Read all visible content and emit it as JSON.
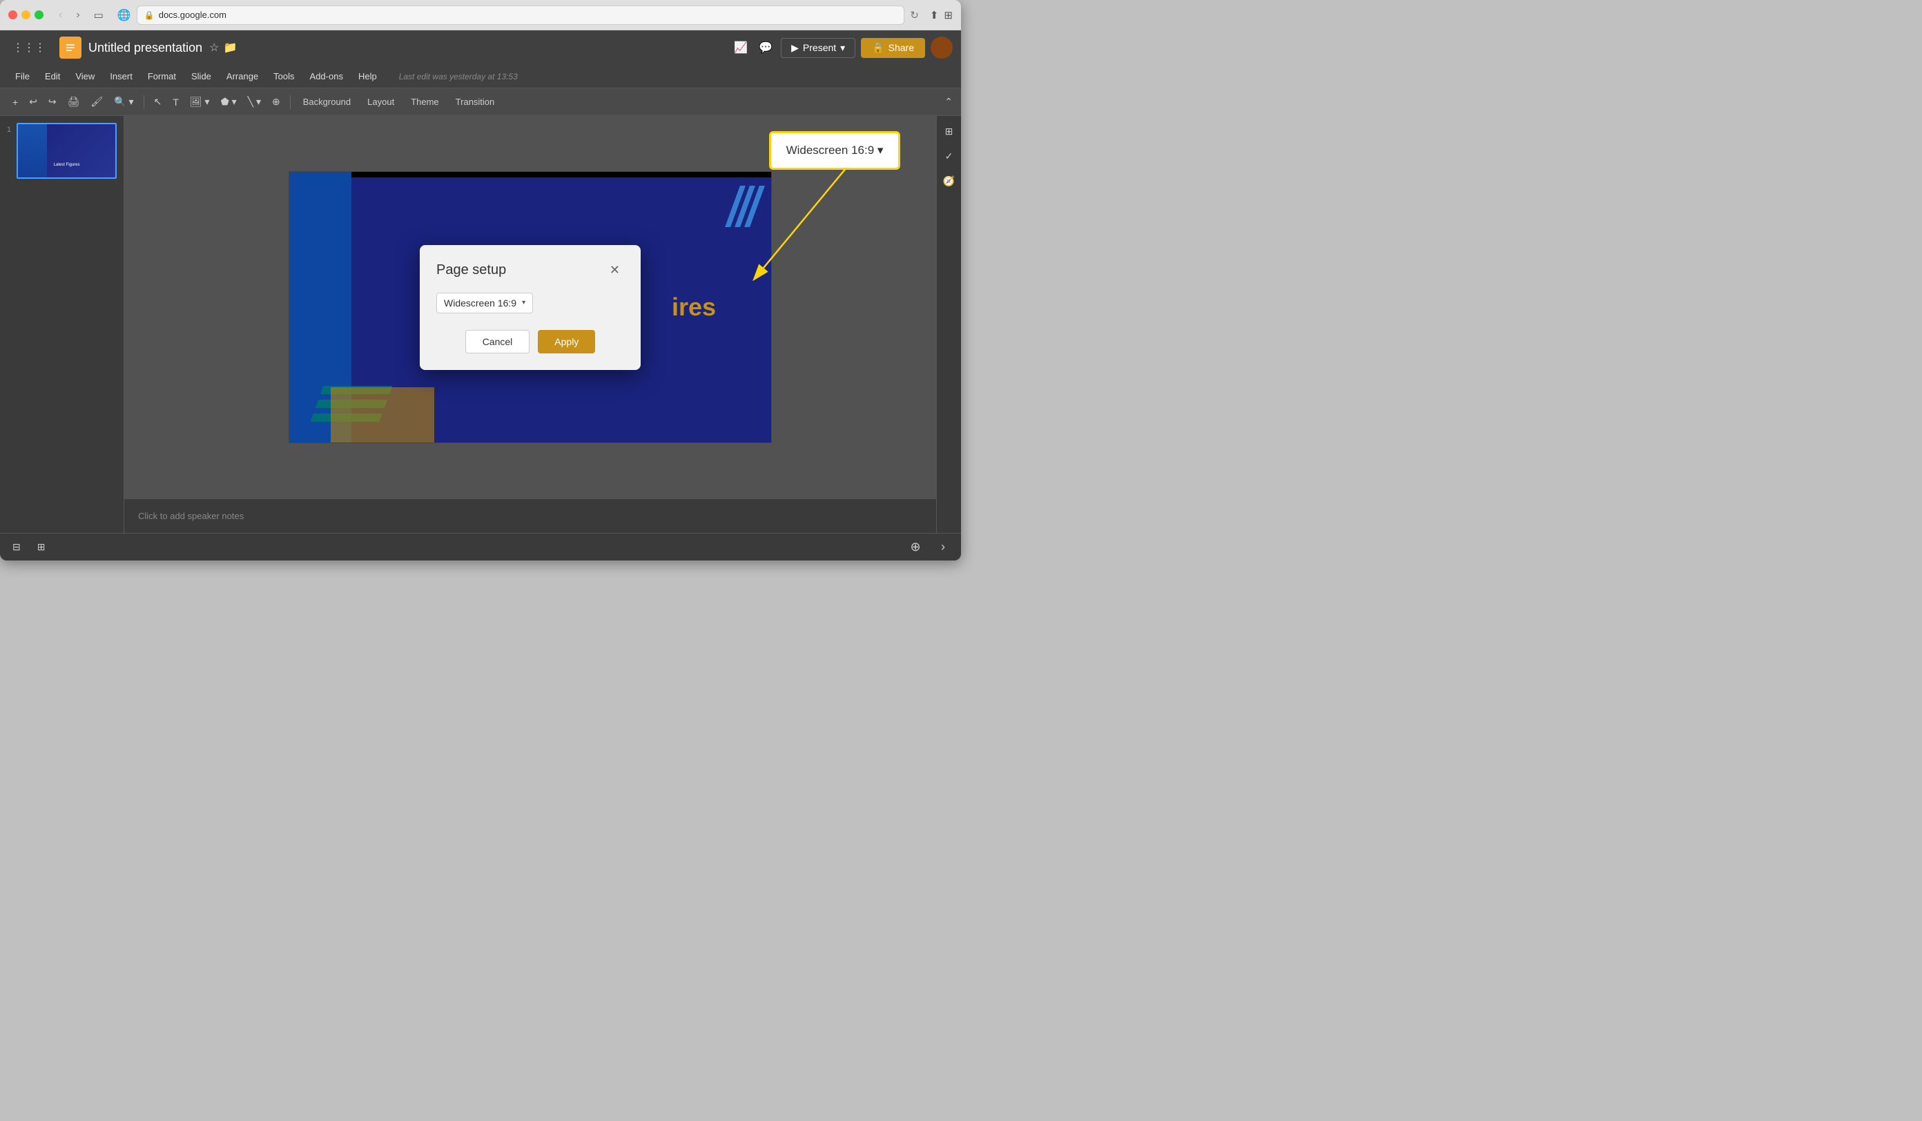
{
  "browser": {
    "url": "docs.google.com",
    "tab_title": "Untitled presentation"
  },
  "app": {
    "title": "Untitled presentation",
    "logo_letter": "",
    "last_edit": "Last edit was yesterday at 13:53"
  },
  "menu": {
    "items": [
      "File",
      "Edit",
      "View",
      "Insert",
      "Format",
      "Slide",
      "Arrange",
      "Tools",
      "Add-ons",
      "Help"
    ]
  },
  "toolbar": {
    "background_label": "Background",
    "layout_label": "Layout",
    "theme_label": "Theme",
    "transition_label": "Transition"
  },
  "header": {
    "present_label": "Present",
    "share_label": "Share"
  },
  "annotation": {
    "label": "Widescreen 16:9 ▾"
  },
  "modal": {
    "title": "Page setup",
    "dropdown_value": "Widescreen 16:9",
    "cancel_label": "Cancel",
    "apply_label": "Apply"
  },
  "speaker_notes": {
    "placeholder": "Click to add speaker notes"
  },
  "slide": {
    "title_text": "res"
  }
}
